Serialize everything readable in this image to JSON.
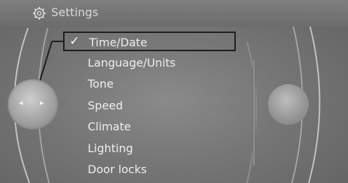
{
  "header": {
    "title": "Settings",
    "icon": "gear-icon"
  },
  "menu": {
    "items": [
      {
        "label": "Time/Date",
        "selected": true
      },
      {
        "label": "Language/Units",
        "selected": false
      },
      {
        "label": "Tone",
        "selected": false
      },
      {
        "label": "Speed",
        "selected": false
      },
      {
        "label": "Climate",
        "selected": false
      },
      {
        "label": "Lighting",
        "selected": false
      },
      {
        "label": "Door locks",
        "selected": false
      }
    ],
    "check_mark": "✓"
  },
  "controller": {
    "left_arrow": "◂",
    "right_arrow": "▸"
  },
  "colors": {
    "background": "#767676",
    "text": "#eeeeee",
    "highlight_border": "#1c1c1c"
  }
}
